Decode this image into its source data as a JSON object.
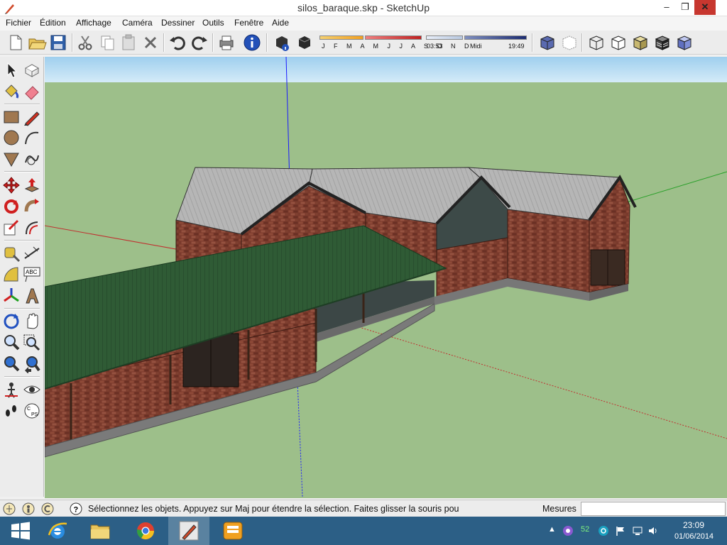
{
  "window": {
    "title": "silos_baraque.skp - SketchUp",
    "min_icon": "minimize-icon",
    "max_icon": "restore-icon",
    "close_icon": "close-icon"
  },
  "menu": [
    "Fichier",
    "Édition",
    "Affichage",
    "Caméra",
    "Dessiner",
    "Outils",
    "Fenêtre",
    "Aide"
  ],
  "shadows": {
    "months": "J F M A M J J A S O N D",
    "time_start": "03:53",
    "time_mid": "Midi",
    "time_end": "19:49"
  },
  "status": {
    "message": "Sélectionnez les objets. Appuyez sur Maj pour étendre la sélection. Faites glisser la souris pou",
    "measure_label": "Mesures",
    "measure_value": ""
  },
  "taskbar": {
    "items": [
      "start-icon",
      "internet-explorer-icon",
      "file-explorer-icon",
      "chrome-icon",
      "sketchup-icon",
      "app-icon"
    ],
    "tray_count": "52",
    "time": "23:09",
    "date": "01/06/2014"
  },
  "colors": {
    "sky": "#a8d4f0",
    "ground": "#9dbf8a",
    "brick": "#7a3a2c",
    "roof_grey": "#b8b8b8",
    "roof_green": "#2f5b35",
    "axis_blue": "#1a1aff",
    "axis_red": "#d02020",
    "axis_green": "#2aa02a",
    "taskbar": "#2c5f86"
  }
}
